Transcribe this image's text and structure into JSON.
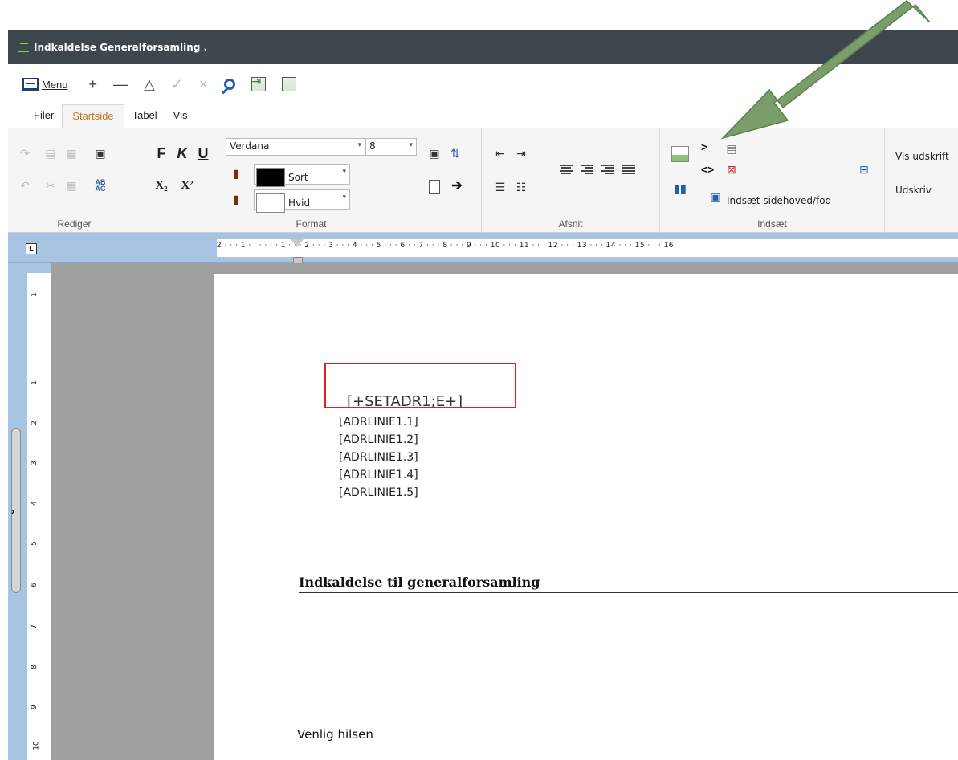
{
  "window": {
    "title": "Indkaldelse Generalforsamling ."
  },
  "toolbar": {
    "menu_label": "Menu",
    "add_glyph": "+",
    "remove_glyph": "—",
    "triangle_glyph": "△",
    "check_glyph": "✓",
    "cancel_glyph": "×"
  },
  "tabs": [
    {
      "label": "Filer"
    },
    {
      "label": "Startside",
      "active": true
    },
    {
      "label": "Tabel"
    },
    {
      "label": "Vis"
    }
  ],
  "ribbon": {
    "groups": {
      "rediger": "Rediger",
      "format": "Format",
      "afsnit": "Afsnit",
      "indsaet": "Indsæt"
    },
    "font": {
      "name": "Verdana",
      "size": "8"
    },
    "text_color": {
      "name": "Sort",
      "swatch": "#000000"
    },
    "background_color": {
      "name": "Hvid",
      "swatch": "#ffffff"
    },
    "format_buttons": {
      "bold": "F",
      "italic": "K",
      "underline": "U"
    },
    "insert_header_footer": "Indsæt sidehoved/fod",
    "print_preview": "Vis udskrift",
    "print": "Udskriv",
    "prompt_glyph": ">_",
    "code_glyph": "<>"
  },
  "ruler": {
    "corner": "L",
    "marks": "2 · · · 1 · · ·   · · · 1 · · · 2 · · · 3 · · · 4 · · ·  5 · · · 6  · · 7 · · · 8 · · · 9 · · · 10 · · · 11 · · · 12 · · · 13 · · · 14 · · · 15 · · · 16",
    "vertical_ticks": [
      "1",
      "1",
      "2",
      "3",
      "4",
      "5",
      "6",
      "7",
      "8",
      "9",
      "10"
    ]
  },
  "document": {
    "setadr": "[+SETADR1;E+]",
    "address_lines": [
      "[ADRLINIE1.1]",
      "[ADRLINIE1.2]",
      "[ADRLINIE1.3]",
      "[ADRLINIE1.4]",
      "[ADRLINIE1.5]"
    ],
    "heading": "Indkaldelse til generalforsamling",
    "greeting": "Venlig hilsen"
  },
  "annotations": {
    "arrow_color": "#7a9e69",
    "highlight_color": "#e0211f"
  },
  "colors": {
    "titlebar": "#3e464e",
    "active_tab": "#c8731b",
    "ruler": "#a7c4e2",
    "canvas": "#a0a0a0"
  }
}
